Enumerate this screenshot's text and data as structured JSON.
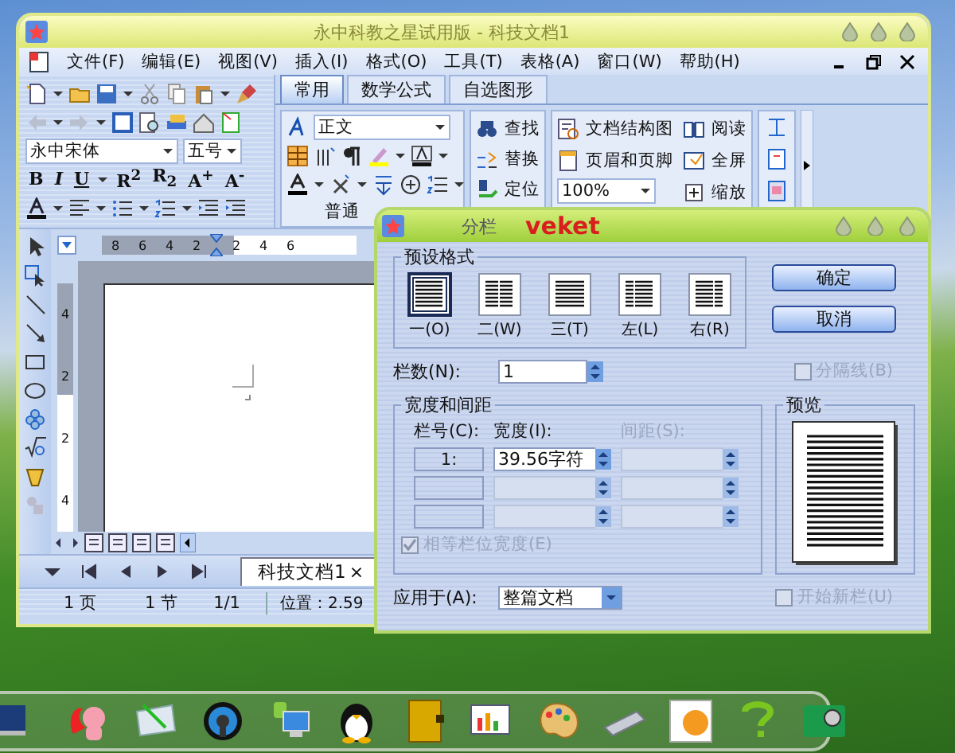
{
  "main_window": {
    "title": "永中科教之星试用版 - 科技文档1",
    "menu": [
      {
        "label": "文件(F)"
      },
      {
        "label": "编辑(E)"
      },
      {
        "label": "视图(V)"
      },
      {
        "label": "插入(I)"
      },
      {
        "label": "格式(O)"
      },
      {
        "label": "工具(T)"
      },
      {
        "label": "表格(A)"
      },
      {
        "label": "窗口(W)"
      },
      {
        "label": "帮助(H)"
      }
    ],
    "font": {
      "name": "永中宋体",
      "size": "五号"
    },
    "format_buttons": [
      "B",
      "I",
      "U",
      "R$^{2}$",
      "R$_{2}$",
      "A$^{+}$",
      "A$^{-}$"
    ],
    "tabs": [
      {
        "label": "常用",
        "selected": true
      },
      {
        "label": "数学公式",
        "selected": false
      },
      {
        "label": "自选图形",
        "selected": false
      }
    ],
    "style": "正文",
    "group_label": "普通",
    "find_buttons": [
      {
        "label": "查找",
        "kind": "find"
      },
      {
        "label": "替换",
        "kind": "replace"
      },
      {
        "label": "定位",
        "kind": "goto"
      }
    ],
    "view_buttons": [
      {
        "label": "文档结构图",
        "kind": "outline"
      },
      {
        "label": "页眉和页脚",
        "kind": "header"
      }
    ],
    "zoom": "100%",
    "read_buttons": [
      {
        "label": "阅读",
        "kind": "read"
      },
      {
        "label": "全屏",
        "kind": "fullscreen"
      },
      {
        "label": "缩放",
        "kind": "zoom"
      }
    ],
    "ruler_h": [
      "8",
      "6",
      "4",
      "2",
      "2",
      "4",
      "6"
    ],
    "ruler_v": [
      "4",
      "2",
      "2",
      "4"
    ],
    "doc_tabs": [
      {
        "label": "科技文档1",
        "close": "×",
        "selected": true
      }
    ],
    "status": [
      "1 页",
      "1 节",
      "1/1",
      "位置：2.59"
    ]
  },
  "dialog": {
    "title": "分栏",
    "brand": "veket",
    "presets_label": "预设格式",
    "presets": [
      {
        "label": "一(O)",
        "kind": "one",
        "selected": true
      },
      {
        "label": "二(W)",
        "kind": "two",
        "selected": false
      },
      {
        "label": "三(T)",
        "kind": "three",
        "selected": false
      },
      {
        "label": "左(L)",
        "kind": "left",
        "selected": false
      },
      {
        "label": "右(R)",
        "kind": "right",
        "selected": false
      }
    ],
    "buttons": [
      "确定",
      "取消"
    ],
    "columns_label": "栏数(N):",
    "columns_value": "1",
    "separator": {
      "label": "分隔线(B)",
      "checked": false,
      "disabled": true
    },
    "width_label": "宽度和间距",
    "headers": [
      "栏号(C):",
      "宽度(I):",
      "间距(S):"
    ],
    "rows": [
      {
        "number": "1:",
        "width": "39.56字符",
        "disabled": false
      },
      {
        "disabled": true
      },
      {
        "disabled": true
      }
    ],
    "equal_width": {
      "label": "相等栏位宽度(E)",
      "checked": true,
      "disabled": true
    },
    "preview_label": "预览",
    "apply_label": "应用于(A):",
    "apply_value": "整篇文档",
    "new_column": {
      "label": "开始新栏(U)",
      "checked": false,
      "disabled": true
    }
  },
  "dock": [
    {
      "kind": "monitor"
    },
    {
      "kind": "animal"
    },
    {
      "kind": "notepad"
    },
    {
      "kind": "speaker"
    },
    {
      "kind": "computer"
    },
    {
      "kind": "penguin"
    },
    {
      "kind": "book"
    },
    {
      "kind": "chart"
    },
    {
      "kind": "palette"
    },
    {
      "kind": "usb"
    },
    {
      "kind": "picture"
    },
    {
      "kind": "question"
    },
    {
      "kind": "camera"
    }
  ]
}
